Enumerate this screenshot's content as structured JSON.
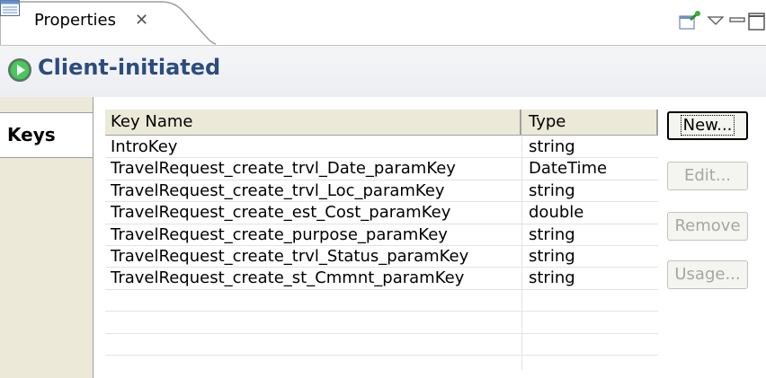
{
  "tab": {
    "label": "Properties",
    "close_glyph": "✕",
    "icon": "properties-icon"
  },
  "toolbar": {
    "pin_icon": "pin-editor-icon",
    "menu_icon": "view-menu-icon",
    "minimize_icon": "minimize-icon",
    "maximize_icon": "maximize-icon"
  },
  "section": {
    "title": "Client-initiated",
    "icon": "green-play-icon"
  },
  "side_tab": {
    "label": "Keys"
  },
  "table": {
    "headers": {
      "key_name": "Key Name",
      "type": "Type"
    },
    "rows": [
      {
        "key": "IntroKey",
        "type": "string"
      },
      {
        "key": "TravelRequest_create_trvl_Date_paramKey",
        "type": "DateTime"
      },
      {
        "key": "TravelRequest_create_trvl_Loc_paramKey",
        "type": "string"
      },
      {
        "key": "TravelRequest_create_est_Cost_paramKey",
        "type": "double"
      },
      {
        "key": "TravelRequest_create_purpose_paramKey",
        "type": "string"
      },
      {
        "key": "TravelRequest_create_trvl_Status_paramKey",
        "type": "string"
      },
      {
        "key": "TravelRequest_create_st_Cmmnt_paramKey",
        "type": "string"
      },
      {
        "key": "",
        "type": ""
      },
      {
        "key": "",
        "type": ""
      },
      {
        "key": "",
        "type": ""
      }
    ]
  },
  "buttons": {
    "new": "New...",
    "edit": "Edit...",
    "remove": "Remove",
    "usage": "Usage..."
  },
  "colors": {
    "title": "#2b4c7e",
    "disabled_text": "#a7a6a0",
    "header_bg": "#ece9d8"
  }
}
